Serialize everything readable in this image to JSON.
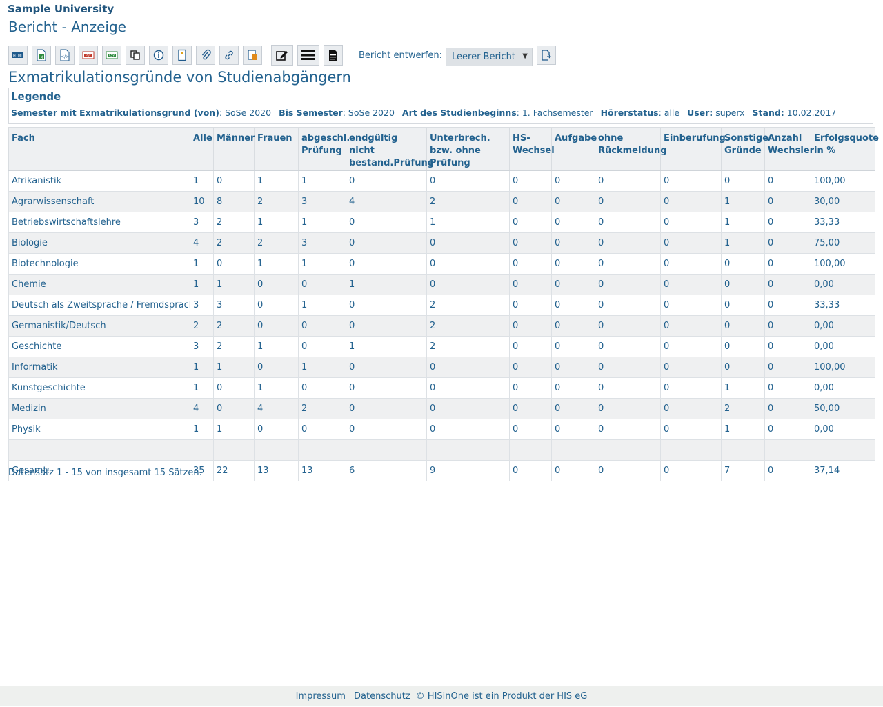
{
  "header": {
    "university": "Sample University",
    "title": "Bericht - Anzeige"
  },
  "toolbar": {
    "icons": [
      "html-export-icon",
      "excel-export-icon",
      "xml-export-icon",
      "pdf-export-icon",
      "csv-export-icon",
      "copy-icon",
      "info-icon",
      "notebook-icon",
      "attachment-icon",
      "link-icon",
      "edit-report-icon",
      "edit-layout-icon",
      "table-layout-icon",
      "document-icon",
      "open-design-icon"
    ],
    "design_label": "Bericht entwerfen:",
    "design_value": "Leerer Bericht"
  },
  "report": {
    "title": "Exmatrikulationsgründe von Studienabgängern",
    "legend_title": "Legende",
    "legend": [
      {
        "label": "Semester mit Exmatrikulationsgrund (von)",
        "value": "SoSe 2020"
      },
      {
        "label": "Bis Semester",
        "value": "SoSe 2020"
      },
      {
        "label": "Art des Studienbeginns",
        "value": "1. Fachsemester"
      },
      {
        "label": "Hörerstatus",
        "value": "alle"
      },
      {
        "label": "User:",
        "value": "superx"
      },
      {
        "label": "Stand:",
        "value": "10.02.2017"
      }
    ]
  },
  "table": {
    "headers": [
      "Fach",
      "Alle",
      "Männer",
      "Frauen",
      "",
      "abgeschl. Prüfung",
      "endgültig nicht bestand.Prüfung",
      "Unterbrech. bzw. ohne Prüfung",
      "HS-Wechsel",
      "Aufgabe",
      "ohne Rückmeldung",
      "Einberufung",
      "Sonstige Gründe",
      "Anzahl Wechsler",
      "Erfolgsquote in %"
    ],
    "rows": [
      [
        "Afrikanistik",
        "1",
        "0",
        "1",
        "",
        "1",
        "0",
        "0",
        "0",
        "0",
        "0",
        "0",
        "0",
        "0",
        "100,00"
      ],
      [
        "Agrarwissenschaft",
        "10",
        "8",
        "2",
        "",
        "3",
        "4",
        "2",
        "0",
        "0",
        "0",
        "0",
        "1",
        "0",
        "30,00"
      ],
      [
        "Betriebswirtschaftslehre",
        "3",
        "2",
        "1",
        "",
        "1",
        "0",
        "1",
        "0",
        "0",
        "0",
        "0",
        "1",
        "0",
        "33,33"
      ],
      [
        "Biologie",
        "4",
        "2",
        "2",
        "",
        "3",
        "0",
        "0",
        "0",
        "0",
        "0",
        "0",
        "1",
        "0",
        "75,00"
      ],
      [
        "Biotechnologie",
        "1",
        "0",
        "1",
        "",
        "1",
        "0",
        "0",
        "0",
        "0",
        "0",
        "0",
        "0",
        "0",
        "100,00"
      ],
      [
        "Chemie",
        "1",
        "1",
        "0",
        "",
        "0",
        "1",
        "0",
        "0",
        "0",
        "0",
        "0",
        "0",
        "0",
        "0,00"
      ],
      [
        "Deutsch als Zweitsprache / Fremdsprache",
        "3",
        "3",
        "0",
        "",
        "1",
        "0",
        "2",
        "0",
        "0",
        "0",
        "0",
        "0",
        "0",
        "33,33"
      ],
      [
        "Germanistik/Deutsch",
        "2",
        "2",
        "0",
        "",
        "0",
        "0",
        "2",
        "0",
        "0",
        "0",
        "0",
        "0",
        "0",
        "0,00"
      ],
      [
        "Geschichte",
        "3",
        "2",
        "1",
        "",
        "0",
        "1",
        "2",
        "0",
        "0",
        "0",
        "0",
        "0",
        "0",
        "0,00"
      ],
      [
        "Informatik",
        "1",
        "1",
        "0",
        "",
        "1",
        "0",
        "0",
        "0",
        "0",
        "0",
        "0",
        "0",
        "0",
        "100,00"
      ],
      [
        "Kunstgeschichte",
        "1",
        "0",
        "1",
        "",
        "0",
        "0",
        "0",
        "0",
        "0",
        "0",
        "0",
        "1",
        "0",
        "0,00"
      ],
      [
        "Medizin",
        "4",
        "0",
        "4",
        "",
        "2",
        "0",
        "0",
        "0",
        "0",
        "0",
        "0",
        "2",
        "0",
        "50,00"
      ],
      [
        "Physik",
        "1",
        "1",
        "0",
        "",
        "0",
        "0",
        "0",
        "0",
        "0",
        "0",
        "0",
        "1",
        "0",
        "0,00"
      ],
      [
        "",
        "",
        "",
        "",
        "",
        "",
        "",
        "",
        "",
        "",
        "",
        "",
        "",
        "",
        ""
      ],
      [
        "Gesamt:",
        "35",
        "22",
        "13",
        "",
        "13",
        "6",
        "9",
        "0",
        "0",
        "0",
        "0",
        "7",
        "0",
        "37,14"
      ]
    ]
  },
  "dataset_info": "Datensatz 1 - 15 von insgesamt 15 Sätzen.",
  "footer": {
    "impressum": "Impressum",
    "datenschutz": "Datenschutz",
    "copyright": "© HISinOne ist ein Produkt der HIS eG"
  }
}
